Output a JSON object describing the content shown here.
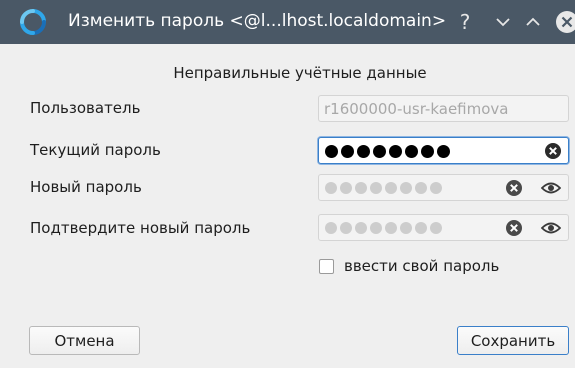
{
  "window": {
    "title": "Изменить пароль <@l...lhost.localdomain>",
    "help_glyph": "?",
    "icons": {
      "logo": "app-logo-icon",
      "help": "help-icon",
      "minimize": "chevron-down-icon",
      "maximize": "chevron-up-icon",
      "close": "close-icon"
    }
  },
  "message": "Неправильные учётные данные",
  "form": {
    "user_label": "Пользователь",
    "user_value": "r1600000-usr-kaefimova",
    "current_password_label": "Текущий пароль",
    "current_password_masked": "●●●●●●●●",
    "new_password_label": "Новый пароль",
    "new_password_masked": "●●●●●●●●",
    "confirm_password_label": "Подтвердите новый пароль",
    "confirm_password_masked": "●●●●●●●●",
    "custom_password_checkbox_label": "ввести свой пароль",
    "custom_password_checked": false
  },
  "buttons": {
    "cancel": "Отмена",
    "save": "Сохранить"
  },
  "colors": {
    "titlebar": "#4a5866",
    "background": "#efefef",
    "focus_accent": "#3a7fc9"
  }
}
